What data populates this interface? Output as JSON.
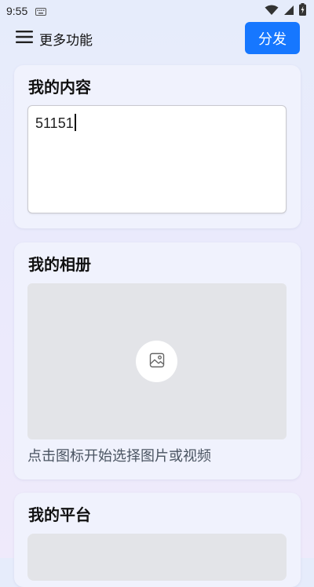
{
  "status_bar": {
    "time": "9:55",
    "icons": [
      "keyboard-icon",
      "wifi-icon",
      "signal-icon",
      "battery-charging-icon"
    ]
  },
  "header": {
    "menu_icon": "hamburger-menu-icon",
    "more_label": "更多功能",
    "distribute_label": "分发"
  },
  "content_section": {
    "title": "我的内容",
    "text_value": "51151"
  },
  "album_section": {
    "title": "我的相册",
    "picker_icon": "image-icon",
    "hint": "点击图标开始选择图片或视频"
  },
  "platform_section": {
    "title": "我的平台"
  },
  "colors": {
    "accent": "#1677ff",
    "placeholder_bg": "#e3e4e8",
    "card_bg": "#f0f2fd"
  }
}
